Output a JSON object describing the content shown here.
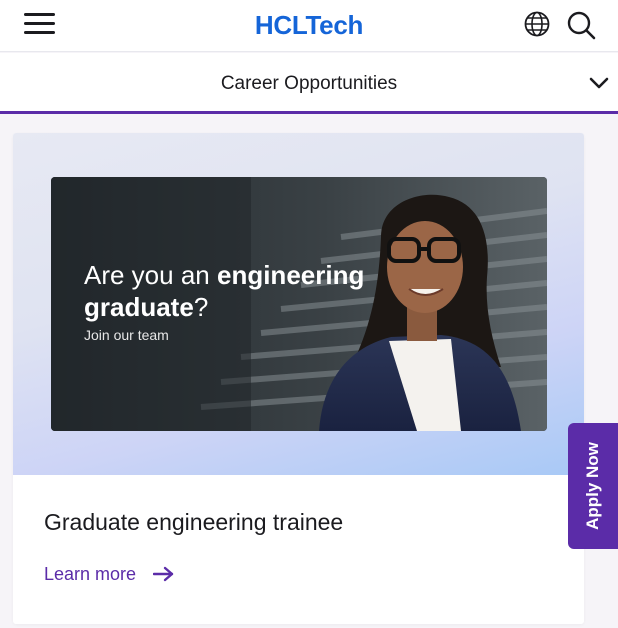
{
  "header": {
    "logo_text": "HCLTech",
    "logo_color": "#1565d8",
    "menu_icon": "hamburger-menu-icon",
    "globe_icon": "globe-icon",
    "search_icon": "search-icon"
  },
  "section": {
    "title": "Career Opportunities",
    "toggle_icon": "chevron-down-icon",
    "accent_color": "#5b2ca8"
  },
  "card": {
    "banner": {
      "headline_prefix": "Are you an ",
      "headline_bold_1": "engineering",
      "headline_bold_2": "graduate",
      "headline_suffix": "?",
      "subtext": "Join our team"
    },
    "title": "Graduate engineering trainee",
    "link_label": "Learn more",
    "link_icon": "arrow-right-icon"
  },
  "apply_tab": {
    "label": "Apply Now",
    "color": "#5b2ca8"
  }
}
